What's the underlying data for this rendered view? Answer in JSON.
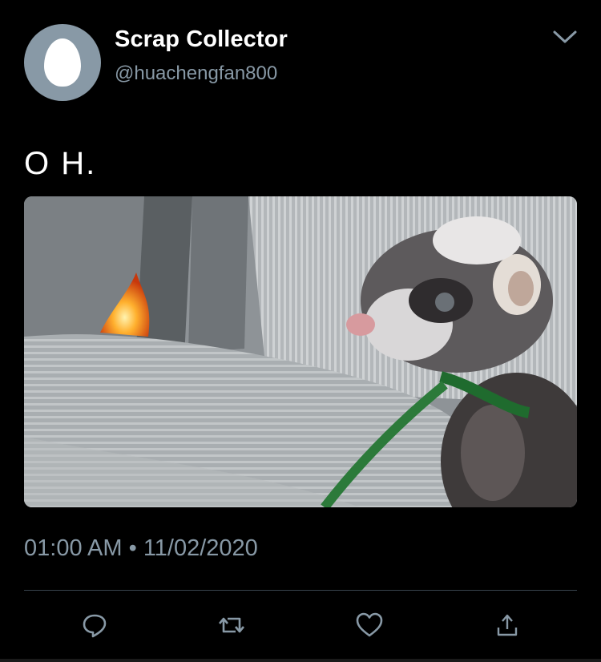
{
  "tweet": {
    "author": {
      "display_name": "Scrap Collector",
      "handle": "@huachengfan800",
      "avatar_icon": "default-egg-avatar"
    },
    "menu_icon": "chevron-down-icon",
    "text": "O H.",
    "media": {
      "kind": "image",
      "alt": ""
    },
    "time": "01:00 AM",
    "separator": "•",
    "date": "11/02/2020"
  },
  "actions": [
    {
      "name": "reply",
      "icon": "speech-bubble-icon"
    },
    {
      "name": "retweet",
      "icon": "retweet-icon"
    },
    {
      "name": "like",
      "icon": "heart-icon"
    },
    {
      "name": "share",
      "icon": "share-icon"
    }
  ],
  "colors": {
    "background": "#000000",
    "primary_text": "#ffffff",
    "secondary_text": "#8899a6",
    "divider": "#38444d"
  }
}
